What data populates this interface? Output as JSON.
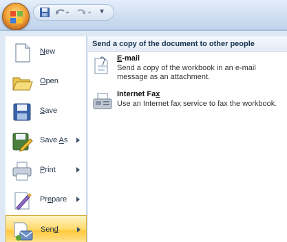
{
  "quick_access": {
    "save_icon": "save-icon",
    "undo_icon": "undo-icon",
    "redo_icon": "redo-icon",
    "customize_glyph": "▾"
  },
  "menu": {
    "items": [
      {
        "label_pre": "",
        "label_u": "N",
        "label_post": "ew",
        "icon": "new-document-icon"
      },
      {
        "label_pre": "",
        "label_u": "O",
        "label_post": "pen",
        "icon": "open-folder-icon"
      },
      {
        "label_pre": "",
        "label_u": "S",
        "label_post": "ave",
        "icon": "save-icon"
      },
      {
        "label_pre": "Save ",
        "label_u": "A",
        "label_post": "s",
        "icon": "save-as-icon"
      },
      {
        "label_pre": "",
        "label_u": "P",
        "label_post": "rint",
        "icon": "printer-icon"
      },
      {
        "label_pre": "Pr",
        "label_u": "e",
        "label_post": "pare",
        "icon": "prepare-icon"
      },
      {
        "label_pre": "Sen",
        "label_u": "d",
        "label_post": "",
        "icon": "send-icon"
      }
    ]
  },
  "panel": {
    "header": "Send a copy of the document to other people",
    "items": [
      {
        "title_u": "E",
        "title_post": "-mail",
        "desc": "Send a copy of the workbook in an e-mail message as an attachment.",
        "icon": "email-icon"
      },
      {
        "title_pre": "Internet Fa",
        "title_u": "x",
        "desc": "Use an Internet fax service to fax the workbook.",
        "icon": "fax-icon"
      }
    ]
  },
  "colors": {
    "selected_highlight": "#ffd966",
    "frame": "#dfe9f5",
    "header_text": "#15324f"
  }
}
